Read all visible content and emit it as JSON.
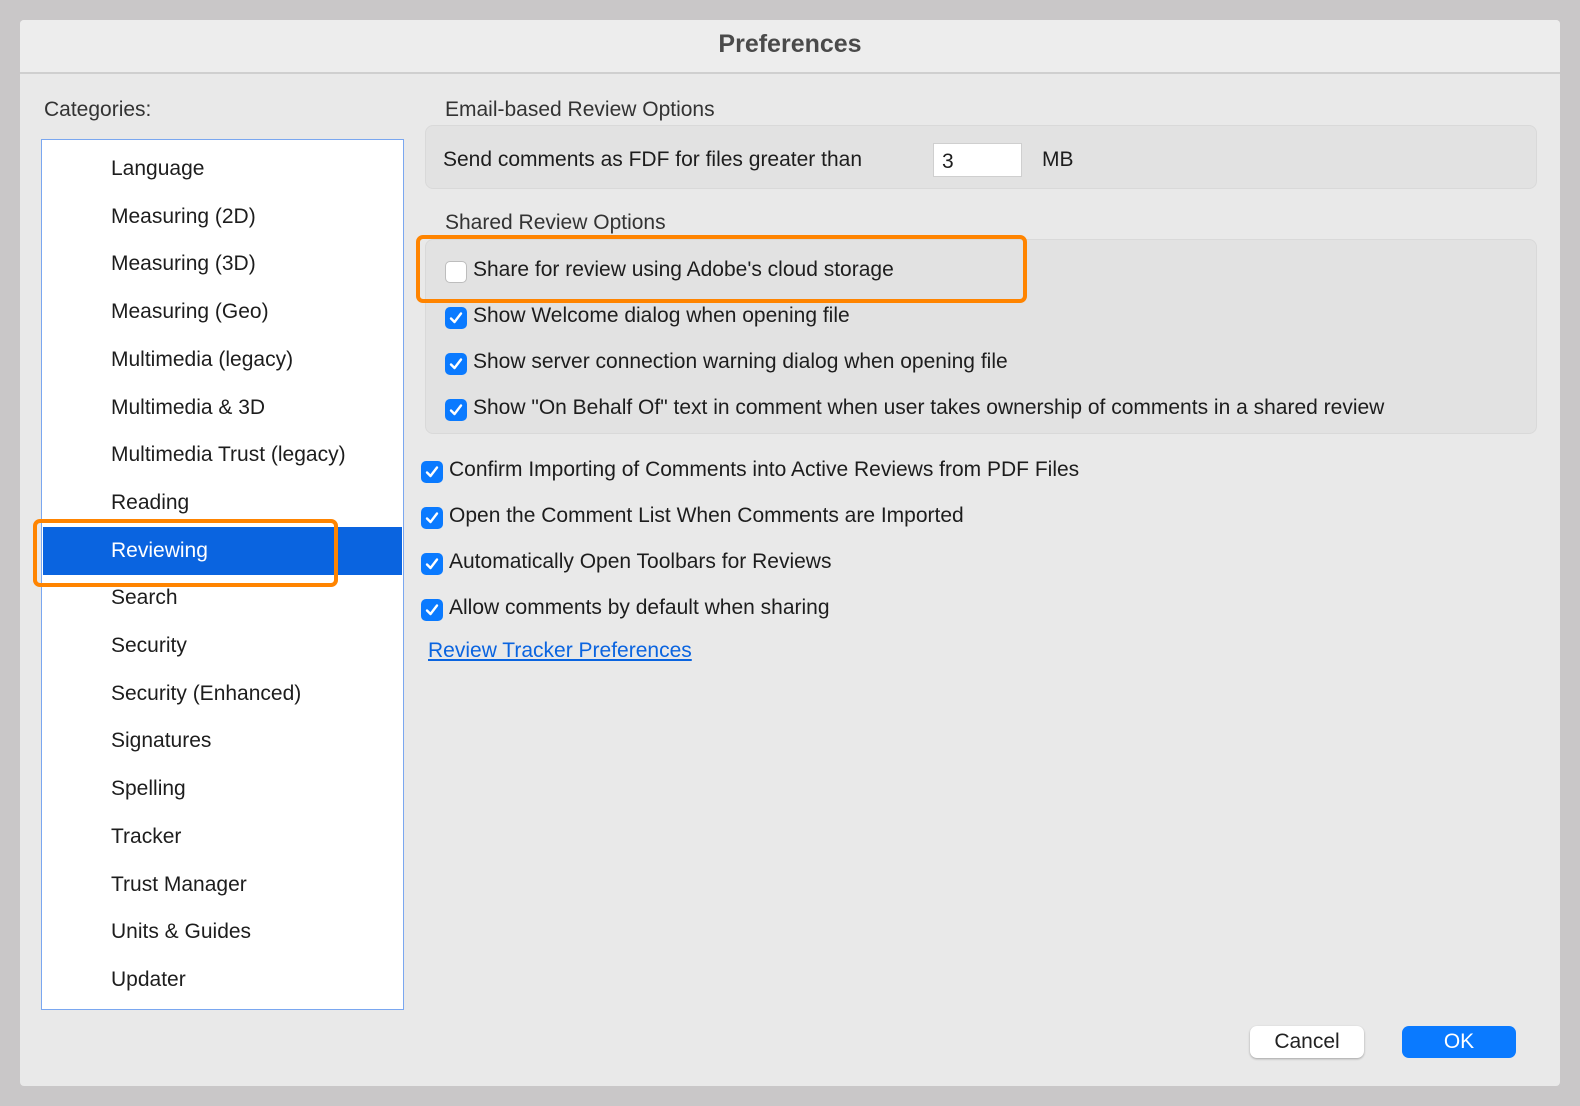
{
  "window": {
    "title": "Preferences"
  },
  "sidebar": {
    "label": "Categories:",
    "selected": "Reviewing",
    "items": [
      "Language",
      "Measuring (2D)",
      "Measuring (3D)",
      "Measuring (Geo)",
      "Multimedia (legacy)",
      "Multimedia & 3D",
      "Multimedia Trust (legacy)",
      "Reading",
      "Reviewing",
      "Search",
      "Security",
      "Security (Enhanced)",
      "Signatures",
      "Spelling",
      "Tracker",
      "Trust Manager",
      "Units & Guides",
      "Updater"
    ]
  },
  "email": {
    "heading": "Email-based Review Options",
    "label": "Send comments as FDF for files greater than",
    "value": "3",
    "unit": "MB"
  },
  "shared": {
    "heading": "Shared Review Options",
    "options": [
      {
        "label": "Share for review using Adobe's cloud storage",
        "checked": false
      },
      {
        "label": "Show Welcome dialog when opening file",
        "checked": true
      },
      {
        "label": "Show server connection warning dialog when opening file",
        "checked": true
      },
      {
        "label": "Show \"On Behalf Of\" text in comment when user takes ownership of comments in a shared review",
        "checked": true
      }
    ]
  },
  "general": {
    "options": [
      {
        "label": "Confirm Importing of Comments into Active Reviews from PDF Files",
        "checked": true
      },
      {
        "label": "Open the Comment List When Comments are Imported",
        "checked": true
      },
      {
        "label": "Automatically Open Toolbars for Reviews",
        "checked": true
      },
      {
        "label": "Allow comments by default when sharing",
        "checked": true
      }
    ],
    "link": "Review Tracker Preferences"
  },
  "buttons": {
    "cancel": "Cancel",
    "ok": "OK"
  },
  "colors": {
    "accent": "#0a7aff",
    "selection": "#0a64e0",
    "highlight": "#ff8400"
  }
}
